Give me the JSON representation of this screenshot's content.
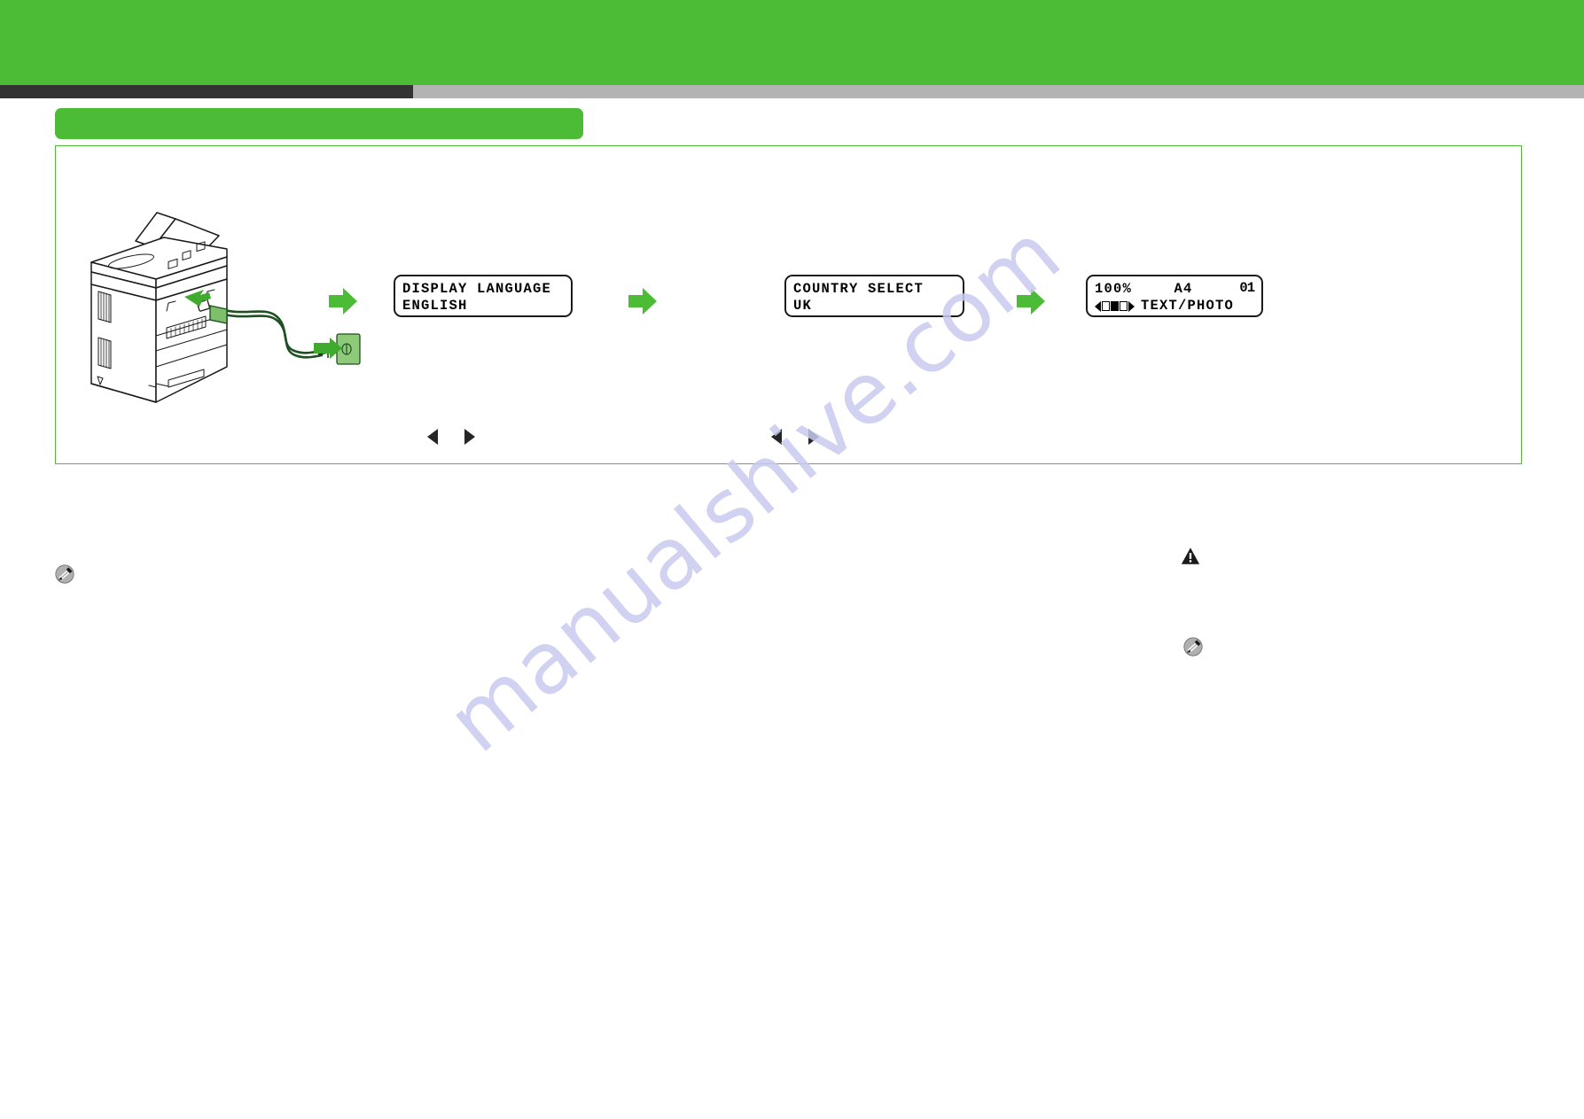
{
  "page": {
    "document_type": "printer-setup-guide-page",
    "background_color": "#ffffff",
    "brand_green": "#4cbb36",
    "rule_dark": "#333333",
    "rule_light": "#b3b3b3"
  },
  "header": {
    "banner_label": "",
    "rule_dark_label": "",
    "rule_light_label": ""
  },
  "section": {
    "tab_label": ""
  },
  "flow": {
    "printer_alt": "rear view of multifunction printer with power cord plugged into wall outlet",
    "arrow_1_label": "next",
    "arrow_2_label": "next",
    "arrow_3_label": "next",
    "steps": [
      {
        "id": "display-language",
        "line1": "DISPLAY LANGUAGE",
        "line2": "ENGLISH"
      },
      {
        "id": "country-select",
        "line1": "COUNTRY SELECT",
        "line2": "UK"
      }
    ],
    "standby_screen": {
      "id": "standby",
      "zoom": "100%",
      "paper_size": "A4",
      "copy_count": "01",
      "image_quality": "TEXT/PHOTO",
      "density_cells": [
        "hollow",
        "filled",
        "hollow"
      ],
      "density_left_cap": "left-arrow",
      "density_right_cap": "right-arrow"
    },
    "nav_hint_1": {
      "left_label": "previous",
      "right_label": "next"
    },
    "nav_hint_2": {
      "left_label": "previous",
      "right_label": "next"
    }
  },
  "notes": {
    "note_left_label": "",
    "caution_label": "",
    "note_right_label": ""
  },
  "watermark": {
    "text": "manualshive.com",
    "color": "#c9c9ef"
  }
}
